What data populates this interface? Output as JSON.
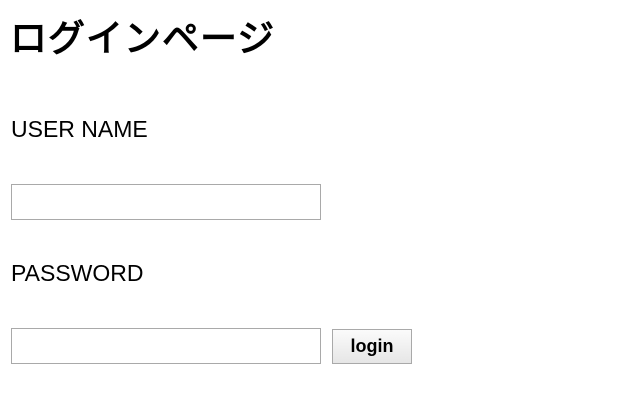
{
  "page": {
    "title": "ログインページ"
  },
  "form": {
    "username_label": "USER NAME",
    "username_value": "",
    "password_label": "PASSWORD",
    "password_value": "",
    "login_label": "login"
  }
}
